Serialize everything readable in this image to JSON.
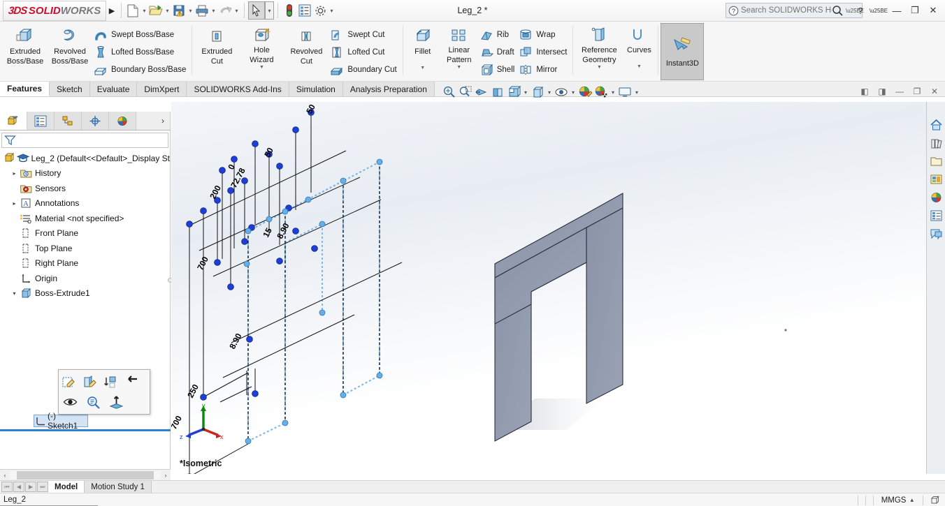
{
  "titlebar": {
    "logo_3ds": "3DS",
    "logo_solid": "SOLID",
    "logo_works": "WORKS",
    "menu_arrow": "▶",
    "document_title": "Leg_2 *",
    "buttons": [
      {
        "name": "new-document",
        "icon": "new-doc-icon",
        "caret": true
      },
      {
        "name": "open-document",
        "icon": "open-folder-icon",
        "caret": true
      },
      {
        "name": "save-document",
        "icon": "save-disk-icon",
        "caret": true
      },
      {
        "name": "print-document",
        "icon": "printer-icon",
        "caret": true
      },
      {
        "name": "undo",
        "icon": "undo-arrow-icon",
        "caret": true
      },
      {
        "name": "select",
        "icon": "cursor-arrow-icon",
        "caret": true
      },
      {
        "name": "rebuild",
        "icon": "traffic-light-icon",
        "caret": false
      },
      {
        "name": "file-properties",
        "icon": "properties-list-icon",
        "caret": false
      },
      {
        "name": "options",
        "icon": "gear-icon",
        "caret": true
      }
    ],
    "search_placeholder": "Search SOLIDWORKS Help",
    "help_label": "?",
    "minimize": "—",
    "restore": "❐",
    "close": "✕"
  },
  "ribbon": {
    "groups": [
      {
        "name": "features-boss",
        "big": [
          {
            "label_line1": "Extruded",
            "label_line2": "Boss/Base",
            "icon": "extruded-boss-icon",
            "dropdown": false
          },
          {
            "label_line1": "Revolved",
            "label_line2": "Boss/Base",
            "icon": "revolved-boss-icon",
            "dropdown": false
          }
        ],
        "small": [
          {
            "label": "Swept Boss/Base",
            "icon": "swept-boss-icon"
          },
          {
            "label": "Lofted Boss/Base",
            "icon": "lofted-boss-icon"
          },
          {
            "label": "Boundary Boss/Base",
            "icon": "boundary-boss-icon"
          }
        ]
      },
      {
        "name": "features-cut",
        "big": [
          {
            "label_line1": "Extruded",
            "label_line2": "Cut",
            "icon": "extruded-cut-icon",
            "dropdown": false
          },
          {
            "label_line1": "Hole",
            "label_line2": "Wizard",
            "icon": "hole-wizard-icon",
            "dropdown": true
          },
          {
            "label_line1": "Revolved",
            "label_line2": "Cut",
            "icon": "revolved-cut-icon",
            "dropdown": false
          }
        ],
        "small": [
          {
            "label": "Swept Cut",
            "icon": "swept-cut-icon"
          },
          {
            "label": "Lofted Cut",
            "icon": "lofted-cut-icon"
          },
          {
            "label": "Boundary Cut",
            "icon": "boundary-cut-icon"
          }
        ]
      },
      {
        "name": "features-modify",
        "big": [
          {
            "label_line1": "Fillet",
            "label_line2": "",
            "icon": "fillet-icon",
            "dropdown": true
          },
          {
            "label_line1": "Linear",
            "label_line2": "Pattern",
            "icon": "linear-pattern-icon",
            "dropdown": true
          }
        ],
        "small": [
          {
            "label": "Rib",
            "icon": "rib-icon"
          },
          {
            "label": "Draft",
            "icon": "draft-icon"
          },
          {
            "label": "Shell",
            "icon": "shell-icon"
          }
        ],
        "small2": [
          {
            "label": "Wrap",
            "icon": "wrap-icon"
          },
          {
            "label": "Intersect",
            "icon": "intersect-icon"
          },
          {
            "label": "Mirror",
            "icon": "mirror-icon"
          }
        ]
      },
      {
        "name": "features-reference",
        "big": [
          {
            "label_line1": "Reference",
            "label_line2": "Geometry",
            "icon": "reference-geometry-icon",
            "dropdown": true
          },
          {
            "label_line1": "Curves",
            "label_line2": "",
            "icon": "curves-icon",
            "dropdown": true
          }
        ],
        "small": []
      }
    ],
    "instant3d": {
      "label": "Instant3D",
      "icon": "instant3d-icon",
      "active": true
    }
  },
  "tabs": {
    "items": [
      {
        "label": "Features",
        "active": true
      },
      {
        "label": "Sketch",
        "active": false
      },
      {
        "label": "Evaluate",
        "active": false
      },
      {
        "label": "DimXpert",
        "active": false
      },
      {
        "label": "SOLIDWORKS Add-Ins",
        "active": false
      },
      {
        "label": "Simulation",
        "active": false
      },
      {
        "label": "Analysis Preparation",
        "active": false
      }
    ]
  },
  "view_toolbar": {
    "buttons": [
      {
        "name": "zoom-to-fit-icon",
        "caret": false
      },
      {
        "name": "zoom-to-area-icon",
        "caret": false
      },
      {
        "name": "previous-view-icon",
        "caret": false
      },
      {
        "name": "section-view-icon",
        "caret": false
      },
      {
        "name": "view-orientation-icon",
        "caret": true
      },
      {
        "name": "display-style-icon",
        "caret": true
      },
      {
        "name": "hide-show-items-icon",
        "caret": true
      },
      {
        "name": "edit-appearance-icon",
        "caret": false
      },
      {
        "name": "apply-scene-icon",
        "caret": true
      },
      {
        "name": "view-settings-icon",
        "caret": true
      }
    ],
    "window_controls": [
      "◧",
      "◨",
      "—",
      "❐",
      "✕"
    ]
  },
  "feature_tree": {
    "tabs": [
      {
        "name": "feature-manager-tab",
        "icon": "feature-tree-icon",
        "active": true
      },
      {
        "name": "property-manager-tab",
        "icon": "property-list-icon",
        "active": false
      },
      {
        "name": "configuration-manager-tab",
        "icon": "configuration-icon",
        "active": false
      },
      {
        "name": "dimxpert-manager-tab",
        "icon": "dimxpert-target-icon",
        "active": false
      },
      {
        "name": "display-manager-tab",
        "icon": "display-sphere-icon",
        "active": false
      }
    ],
    "more_arrow": "›",
    "filter_icon": "filter-funnel-icon",
    "filter_value": "",
    "items": [
      {
        "label": "Leg_2  (Default<<Default>_Display St",
        "icon": "part-doc-icon",
        "twisty": "",
        "indent": 0,
        "bold": false
      },
      {
        "label": "History",
        "icon": "history-icon",
        "twisty": "▸",
        "indent": 1,
        "bold": false
      },
      {
        "label": "Sensors",
        "icon": "sensors-icon",
        "twisty": "",
        "indent": 1,
        "bold": false
      },
      {
        "label": "Annotations",
        "icon": "annotations-icon",
        "twisty": "▸",
        "indent": 1,
        "bold": false
      },
      {
        "label": "Material <not specified>",
        "icon": "material-icon",
        "twisty": "",
        "indent": 1,
        "bold": false
      },
      {
        "label": "Front Plane",
        "icon": "plane-icon",
        "twisty": "",
        "indent": 1,
        "bold": false
      },
      {
        "label": "Top Plane",
        "icon": "plane-icon",
        "twisty": "",
        "indent": 1,
        "bold": false
      },
      {
        "label": "Right Plane",
        "icon": "plane-icon",
        "twisty": "",
        "indent": 1,
        "bold": false
      },
      {
        "label": "Origin",
        "icon": "origin-icon",
        "twisty": "",
        "indent": 1,
        "bold": false
      },
      {
        "label": "Boss-Extrude1",
        "icon": "boss-extrude-icon",
        "twisty": "▾",
        "indent": 1,
        "bold": false
      }
    ],
    "selected_item": {
      "label": "(-) Sketch1",
      "icon": "sketch-icon"
    }
  },
  "context_menu": {
    "row1": [
      {
        "name": "edit-sketch-button",
        "icon": "edit-sketch-icon"
      },
      {
        "name": "edit-sketch-plane-button",
        "icon": "edit-sketch-plane-icon"
      },
      {
        "name": "reorder-button",
        "icon": "reorder-icon"
      },
      {
        "name": "rollback-button",
        "icon": "rollback-arrow-icon"
      }
    ],
    "row2": [
      {
        "name": "show-hide-button",
        "icon": "eye-icon"
      },
      {
        "name": "zoom-to-selection-button",
        "icon": "magnifier-icon"
      },
      {
        "name": "normal-to-button",
        "icon": "normal-to-icon"
      }
    ]
  },
  "graphics": {
    "view_label": "*Isometric",
    "triad": {
      "x": "x",
      "y": "y",
      "z": "z"
    },
    "sketch_dimensions": [
      "0",
      "200",
      "72.78",
      "50",
      "50",
      "15",
      "8.90",
      "8.90",
      "700",
      "250",
      "700"
    ]
  },
  "task_pane": {
    "buttons": [
      {
        "name": "solidworks-resources-button",
        "icon": "home-icon"
      },
      {
        "name": "design-library-button",
        "icon": "design-library-icon"
      },
      {
        "name": "file-explorer-button",
        "icon": "folder-icon"
      },
      {
        "name": "view-palette-button",
        "icon": "view-palette-icon"
      },
      {
        "name": "appearances-scenes-button",
        "icon": "appearances-sphere-icon"
      },
      {
        "name": "custom-properties-button",
        "icon": "custom-properties-icon"
      },
      {
        "name": "solidworks-forum-button",
        "icon": "forum-icon"
      }
    ]
  },
  "bottom": {
    "hscroll_left": "‹",
    "hscroll_right": "›",
    "nav_buttons": [
      "⏮",
      "◀",
      "▶",
      "⏭"
    ],
    "tabs": [
      {
        "label": "Model",
        "active": true
      },
      {
        "label": "Motion Study 1",
        "active": false
      }
    ]
  },
  "statusbar": {
    "message": "Leg_2",
    "units": "MMGS",
    "units_caret": "▴",
    "edit_icon": "editing-part-icon"
  }
}
